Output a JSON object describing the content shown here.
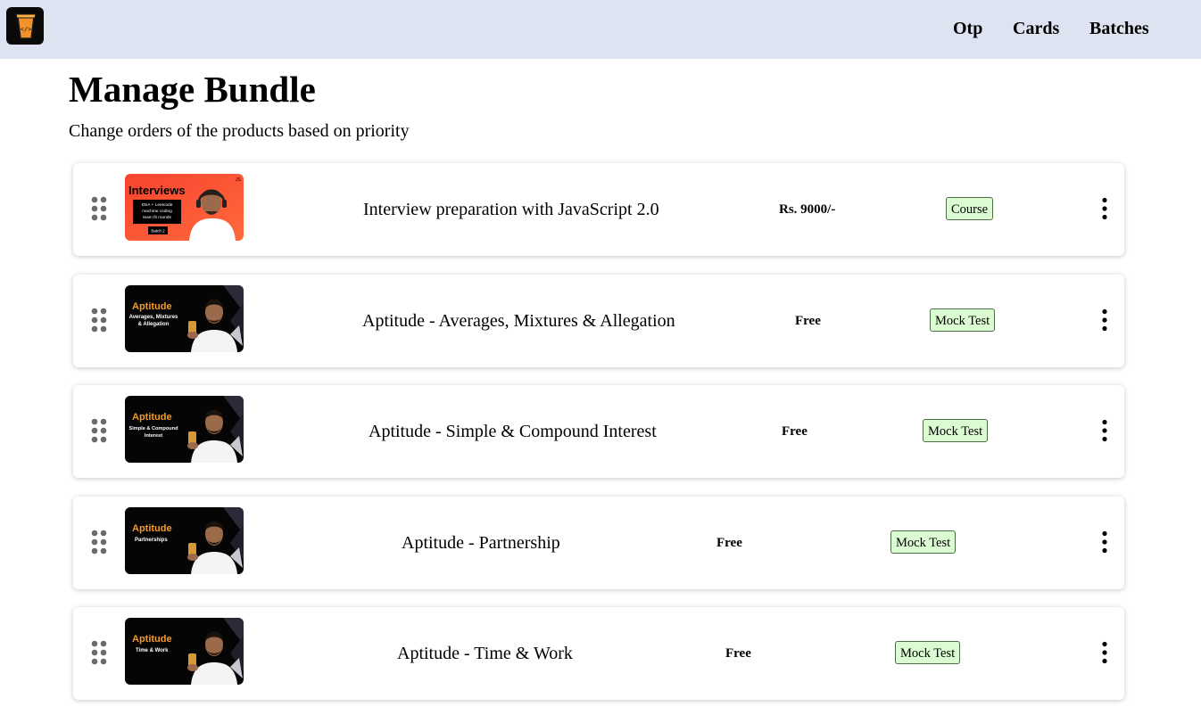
{
  "header": {
    "nav": [
      {
        "label": "Otp"
      },
      {
        "label": "Cards"
      },
      {
        "label": "Batches"
      }
    ]
  },
  "page": {
    "title": "Manage Bundle",
    "subtitle": "Change orders of the products based on priority"
  },
  "products": [
    {
      "name": "Interview preparation with JavaScript 2.0",
      "price": "Rs. 9000/-",
      "type": "Course",
      "thumbnail": {
        "heading": "Interviews",
        "lines": [
          "DSA + Leetcode",
          "machine coding",
          "team fit rounds"
        ],
        "badge": "Batch 2",
        "corner": "JS"
      }
    },
    {
      "name": "Aptitude - Averages, Mixtures & Allegation",
      "price": "Free",
      "type": "Mock Test",
      "thumbnail": {
        "heading": "Aptitude",
        "lines": [
          "Averages, Mixtures",
          "& Allegation"
        ]
      }
    },
    {
      "name": "Aptitude - Simple & Compound Interest",
      "price": "Free",
      "type": "Mock Test",
      "thumbnail": {
        "heading": "Aptitude",
        "lines": [
          "Simple & Compound",
          "Interest"
        ]
      }
    },
    {
      "name": "Aptitude - Partnership",
      "price": "Free",
      "type": "Mock Test",
      "thumbnail": {
        "heading": "Aptitude",
        "lines": [
          "Partnerships"
        ]
      }
    },
    {
      "name": "Aptitude - Time & Work",
      "price": "Free",
      "type": "Mock Test",
      "thumbnail": {
        "heading": "Aptitude",
        "lines": [
          "Time & Work"
        ]
      }
    }
  ],
  "colors": {
    "header_bg": "#dde3f0",
    "tag_bg": "#dbfbd2",
    "interview_thumb_bg": "#f6412f",
    "aptitude_thumb_bg": "#050505",
    "aptitude_heading": "#f39a2b"
  },
  "icons": {
    "logo": "glass-code-logo-icon",
    "drag": "drag-handle-icon",
    "menu": "more-vertical-icon"
  }
}
